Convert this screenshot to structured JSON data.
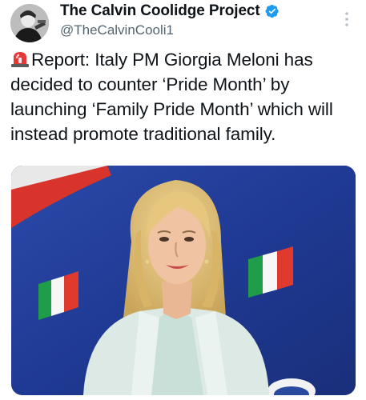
{
  "author": {
    "display_name": "The Calvin Coolidge Project",
    "handle": "@TheCalvinCooli1",
    "verified": true,
    "avatar_icon": "portrait-avatar"
  },
  "tweet": {
    "emoji": "siren-icon",
    "text": "Report: Italy PM Giorgia Meloni has decided to counter ‘Pride Month’ by launching ‘Family Pride Month’ which will instead promote traditional family."
  },
  "colors": {
    "text": "#0f1419",
    "secondary": "#536471",
    "verified": "#1d9bf0",
    "media_bg": "#1e3a8a"
  },
  "media": {
    "image_icon": "photo-woman-italian-flags"
  }
}
